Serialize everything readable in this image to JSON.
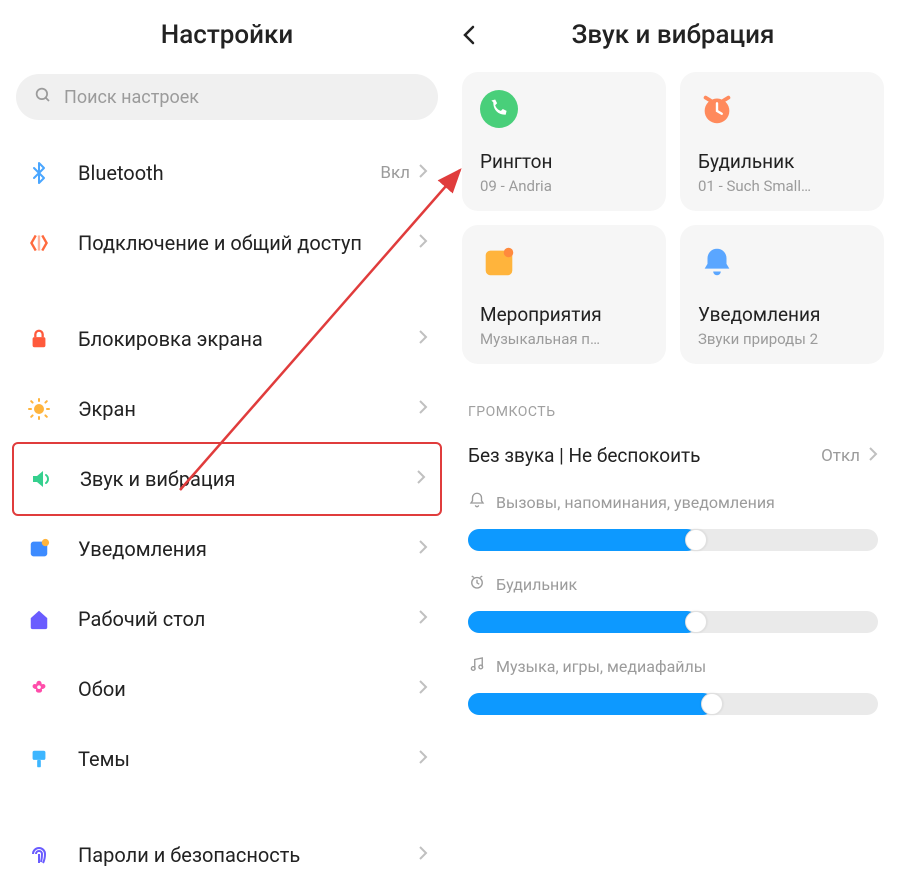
{
  "left": {
    "title": "Настройки",
    "search_placeholder": "Поиск настроек",
    "items": [
      {
        "id": "bluetooth",
        "label": "Bluetooth",
        "status": "Вкл"
      },
      {
        "id": "connection-sharing",
        "label": "Подключение и общий доступ"
      },
      {
        "id": "lock-screen",
        "label": "Блокировка экрана"
      },
      {
        "id": "display",
        "label": "Экран"
      },
      {
        "id": "sound-vibration",
        "label": "Звук и вибрация",
        "highlighted": true
      },
      {
        "id": "notifications",
        "label": "Уведомления"
      },
      {
        "id": "home-screen",
        "label": "Рабочий стол"
      },
      {
        "id": "wallpaper",
        "label": "Обои"
      },
      {
        "id": "themes",
        "label": "Темы"
      },
      {
        "id": "passwords-security",
        "label": "Пароли и безопасность"
      }
    ]
  },
  "right": {
    "title": "Звук и вибрация",
    "cards": [
      {
        "id": "ringtone",
        "title": "Рингтон",
        "subtitle": "09 - Andria"
      },
      {
        "id": "alarm",
        "title": "Будильник",
        "subtitle": "01 - Such Small…"
      },
      {
        "id": "events",
        "title": "Мероприятия",
        "subtitle": "Музыкальная п…"
      },
      {
        "id": "notifications-sound",
        "title": "Уведомления",
        "subtitle": "Звуки природы 2"
      }
    ],
    "volume_section_label": "ГРОМКОСТЬ",
    "silent_dnd": {
      "label": "Без звука | Не беспокоить",
      "status": "Откл"
    },
    "sliders": [
      {
        "id": "calls",
        "label": "Вызовы, напоминания, уведомления",
        "value": 56
      },
      {
        "id": "alarm-vol",
        "label": "Будильник",
        "value": 56
      },
      {
        "id": "media",
        "label": "Музыка, игры, медиафайлы",
        "value": 60
      }
    ]
  }
}
